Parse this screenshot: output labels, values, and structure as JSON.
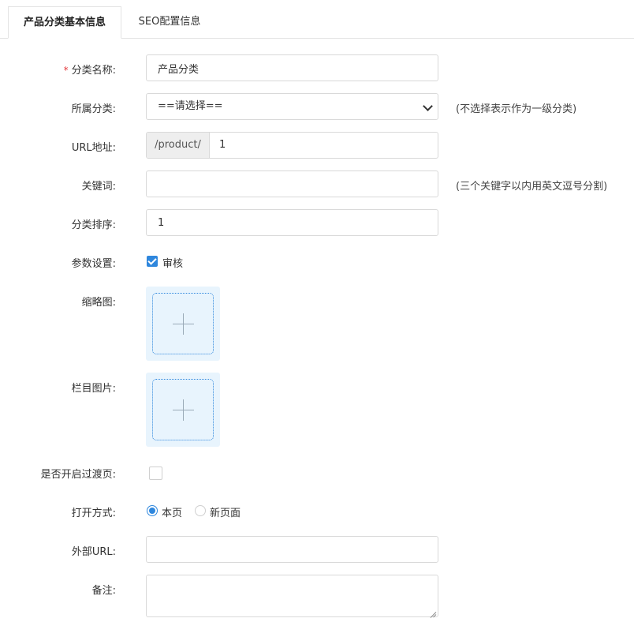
{
  "tabs": [
    {
      "label": "产品分类基本信息",
      "active": true
    },
    {
      "label": "SEO配置信息",
      "active": false
    }
  ],
  "form": {
    "category_name": {
      "label": "分类名称:",
      "required_mark": "*",
      "value": "产品分类"
    },
    "parent_category": {
      "label": "所属分类:",
      "selected": "==请选择==",
      "hint": "(不选择表示作为一级分类)"
    },
    "url": {
      "label": "URL地址:",
      "prefix": "/product/",
      "value": "1"
    },
    "keywords": {
      "label": "关键词:",
      "value": "",
      "hint": "(三个关键字以内用英文逗号分割)"
    },
    "sort_order": {
      "label": "分类排序:",
      "value": "1"
    },
    "params": {
      "label": "参数设置:",
      "audit_label": "审核",
      "audit_checked": true
    },
    "thumbnail": {
      "label": "缩略图:"
    },
    "column_image": {
      "label": "栏目图片:"
    },
    "transition_page": {
      "label": "是否开启过渡页:",
      "checked": false
    },
    "open_mode": {
      "label": "打开方式:",
      "options": [
        "本页",
        "新页面"
      ],
      "selected": "本页"
    },
    "external_url": {
      "label": "外部URL:",
      "value": ""
    },
    "remark": {
      "label": "备注:",
      "value": ""
    }
  },
  "colors": {
    "accent": "#2f87dd",
    "required": "#e4393c",
    "upload_bg": "#e8f4fd"
  }
}
